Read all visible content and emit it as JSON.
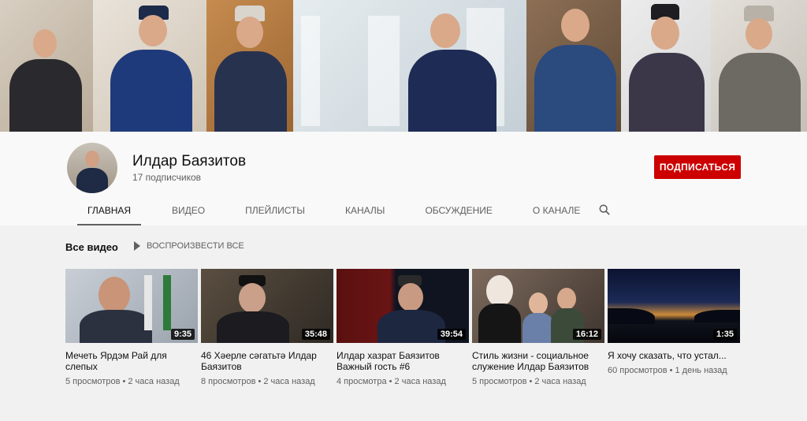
{
  "channel": {
    "name": "Илдар Баязитов",
    "subscribers": "17 подписчиков",
    "subscribe_label": "ПОДПИСАТЬСЯ"
  },
  "tabs": [
    {
      "label": "ГЛАВНАЯ",
      "active": true
    },
    {
      "label": "ВИДЕО"
    },
    {
      "label": "ПЛЕЙЛИСТЫ"
    },
    {
      "label": "КАНАЛЫ"
    },
    {
      "label": "ОБСУЖДЕНИЕ"
    },
    {
      "label": "О КАНАЛЕ"
    }
  ],
  "section": {
    "title": "Все видео",
    "play_all": "ВОСПРОИЗВЕСТИ ВСЕ"
  },
  "videos": [
    {
      "title": "Мечеть Ярдэм Рай для слепых",
      "duration": "9:35",
      "meta": "5 просмотров • 2 часа назад"
    },
    {
      "title": "46 Хәерле сәгатьтә Илдар Баязитов",
      "duration": "35:48",
      "meta": "8 просмотров • 2 часа назад"
    },
    {
      "title": "Илдар хазрат Баязитов Важный гость #6",
      "duration": "39:54",
      "meta": "4 просмотра • 2 часа назад"
    },
    {
      "title": "Стиль жизни - социальное служение Илдар Баязитов",
      "duration": "16:12",
      "meta": "5 просмотров • 2 часа назад"
    },
    {
      "title": "Я хочу сказать, что устал...",
      "duration": "1:35",
      "meta": "60 просмотров • 1 день назад"
    }
  ],
  "colors": {
    "subscribe": "#cc0000",
    "background": "#f1f1f1",
    "header": "#f9f9f9"
  },
  "icons": {
    "search": "search-icon",
    "play": "play-icon"
  }
}
